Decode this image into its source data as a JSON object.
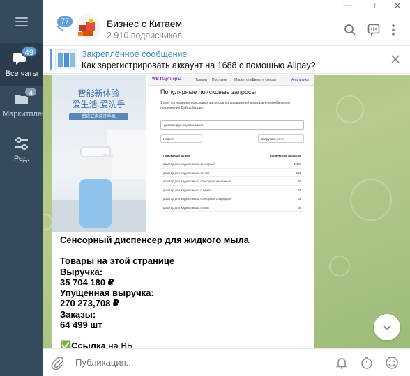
{
  "sidebar": {
    "items": [
      {
        "label": "Все чаты",
        "badge": "49"
      },
      {
        "label": "Маркитплейсы",
        "badge": "4"
      },
      {
        "label": "Ред."
      }
    ]
  },
  "header": {
    "back_badge": "77",
    "channel_title": "Бизнес с Китаем",
    "subscribers": "2 910 подписчиков",
    "window_controls": [
      "—",
      "☐",
      "✕"
    ]
  },
  "pinned": {
    "title": "Закреплённое сообщение",
    "text": "Как зарегистрировать аккаунт на 1688 с помощью Alipay?"
  },
  "message": {
    "image_left_text_1": "智能新体验",
    "image_left_text_2": "爱生活.爱洗手",
    "image_left_caption": "感应式泡沫洗手机",
    "wb_panel": {
      "logo": "WB Партнёры",
      "nav": [
        "Товары",
        "Поставки",
        "Маркетплейс",
        "Цены и скидки",
        "Аналитика"
      ],
      "title": "Популярные поисковые запросы",
      "description": "1 млн популярных поисковых запросов пользователей в магазине и мобильном приложении Вайлдберриз.",
      "search_value": "дозатор для жидкого мыла",
      "period": "Неделя",
      "export": "Выгрузить отчет",
      "col_query": "Поисковый запрос",
      "col_count": "Количество запросов",
      "rows": [
        {
          "q": "дозатор для жидкого мыла сенсорный",
          "n": "1 408"
        },
        {
          "q": "дозатор для жидкого мыла стекло",
          "n": "221"
        },
        {
          "q": "дозатор для жидкого мыла сенсорный настенный",
          "n": "93"
        },
        {
          "q": "дозатор для жидкого мыла с губкой",
          "n": "65"
        },
        {
          "q": "дозатор для жидкого мыла сенсорный с зарядкой",
          "n": "65"
        },
        {
          "q": "дозатор для жидкого мыла серый",
          "n": "56"
        }
      ]
    },
    "lines": [
      "Сенсорный диспенсер для жидкого мыла",
      "",
      "Товары на этой странице",
      "Выручка:",
      "35 704 180 ₽",
      "Упущенная выручка:",
      "270 273,708 ₽",
      "Заказы:",
      "64 499 шт",
      "",
      "✅Ссылка"
    ],
    "link_suffix": " на ВБ"
  },
  "composer": {
    "placeholder": "Публикация..."
  },
  "colors": {
    "sidebar": "#364a5d",
    "accent": "#5ea0dd",
    "wallpaper": "#a8c17e"
  }
}
